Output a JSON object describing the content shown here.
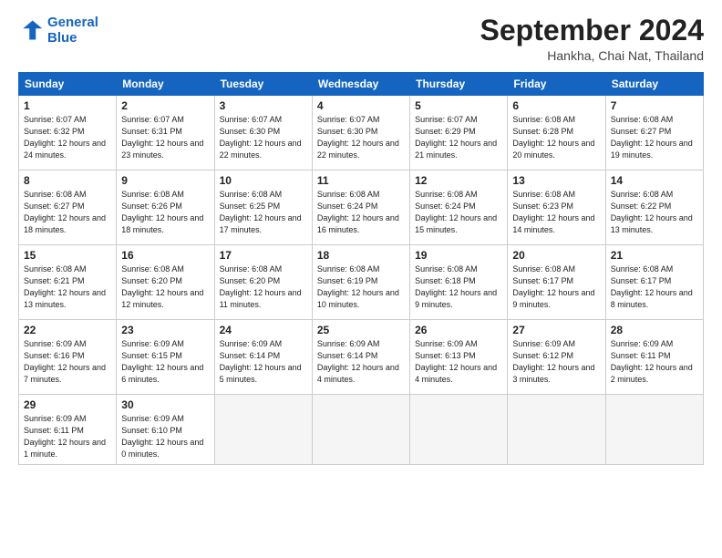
{
  "header": {
    "logo_line1": "General",
    "logo_line2": "Blue",
    "month_title": "September 2024",
    "subtitle": "Hankha, Chai Nat, Thailand"
  },
  "weekdays": [
    "Sunday",
    "Monday",
    "Tuesday",
    "Wednesday",
    "Thursday",
    "Friday",
    "Saturday"
  ],
  "weeks": [
    [
      {
        "day": "1",
        "rise": "6:07 AM",
        "set": "6:32 PM",
        "daylight": "12 hours and 24 minutes."
      },
      {
        "day": "2",
        "rise": "6:07 AM",
        "set": "6:31 PM",
        "daylight": "12 hours and 23 minutes."
      },
      {
        "day": "3",
        "rise": "6:07 AM",
        "set": "6:30 PM",
        "daylight": "12 hours and 22 minutes."
      },
      {
        "day": "4",
        "rise": "6:07 AM",
        "set": "6:30 PM",
        "daylight": "12 hours and 22 minutes."
      },
      {
        "day": "5",
        "rise": "6:07 AM",
        "set": "6:29 PM",
        "daylight": "12 hours and 21 minutes."
      },
      {
        "day": "6",
        "rise": "6:08 AM",
        "set": "6:28 PM",
        "daylight": "12 hours and 20 minutes."
      },
      {
        "day": "7",
        "rise": "6:08 AM",
        "set": "6:27 PM",
        "daylight": "12 hours and 19 minutes."
      }
    ],
    [
      {
        "day": "8",
        "rise": "6:08 AM",
        "set": "6:27 PM",
        "daylight": "12 hours and 18 minutes."
      },
      {
        "day": "9",
        "rise": "6:08 AM",
        "set": "6:26 PM",
        "daylight": "12 hours and 18 minutes."
      },
      {
        "day": "10",
        "rise": "6:08 AM",
        "set": "6:25 PM",
        "daylight": "12 hours and 17 minutes."
      },
      {
        "day": "11",
        "rise": "6:08 AM",
        "set": "6:24 PM",
        "daylight": "12 hours and 16 minutes."
      },
      {
        "day": "12",
        "rise": "6:08 AM",
        "set": "6:24 PM",
        "daylight": "12 hours and 15 minutes."
      },
      {
        "day": "13",
        "rise": "6:08 AM",
        "set": "6:23 PM",
        "daylight": "12 hours and 14 minutes."
      },
      {
        "day": "14",
        "rise": "6:08 AM",
        "set": "6:22 PM",
        "daylight": "12 hours and 13 minutes."
      }
    ],
    [
      {
        "day": "15",
        "rise": "6:08 AM",
        "set": "6:21 PM",
        "daylight": "12 hours and 13 minutes."
      },
      {
        "day": "16",
        "rise": "6:08 AM",
        "set": "6:20 PM",
        "daylight": "12 hours and 12 minutes."
      },
      {
        "day": "17",
        "rise": "6:08 AM",
        "set": "6:20 PM",
        "daylight": "12 hours and 11 minutes."
      },
      {
        "day": "18",
        "rise": "6:08 AM",
        "set": "6:19 PM",
        "daylight": "12 hours and 10 minutes."
      },
      {
        "day": "19",
        "rise": "6:08 AM",
        "set": "6:18 PM",
        "daylight": "12 hours and 9 minutes."
      },
      {
        "day": "20",
        "rise": "6:08 AM",
        "set": "6:17 PM",
        "daylight": "12 hours and 9 minutes."
      },
      {
        "day": "21",
        "rise": "6:08 AM",
        "set": "6:17 PM",
        "daylight": "12 hours and 8 minutes."
      }
    ],
    [
      {
        "day": "22",
        "rise": "6:09 AM",
        "set": "6:16 PM",
        "daylight": "12 hours and 7 minutes."
      },
      {
        "day": "23",
        "rise": "6:09 AM",
        "set": "6:15 PM",
        "daylight": "12 hours and 6 minutes."
      },
      {
        "day": "24",
        "rise": "6:09 AM",
        "set": "6:14 PM",
        "daylight": "12 hours and 5 minutes."
      },
      {
        "day": "25",
        "rise": "6:09 AM",
        "set": "6:14 PM",
        "daylight": "12 hours and 4 minutes."
      },
      {
        "day": "26",
        "rise": "6:09 AM",
        "set": "6:13 PM",
        "daylight": "12 hours and 4 minutes."
      },
      {
        "day": "27",
        "rise": "6:09 AM",
        "set": "6:12 PM",
        "daylight": "12 hours and 3 minutes."
      },
      {
        "day": "28",
        "rise": "6:09 AM",
        "set": "6:11 PM",
        "daylight": "12 hours and 2 minutes."
      }
    ],
    [
      {
        "day": "29",
        "rise": "6:09 AM",
        "set": "6:11 PM",
        "daylight": "12 hours and 1 minute."
      },
      {
        "day": "30",
        "rise": "6:09 AM",
        "set": "6:10 PM",
        "daylight": "12 hours and 0 minutes."
      },
      null,
      null,
      null,
      null,
      null
    ]
  ]
}
